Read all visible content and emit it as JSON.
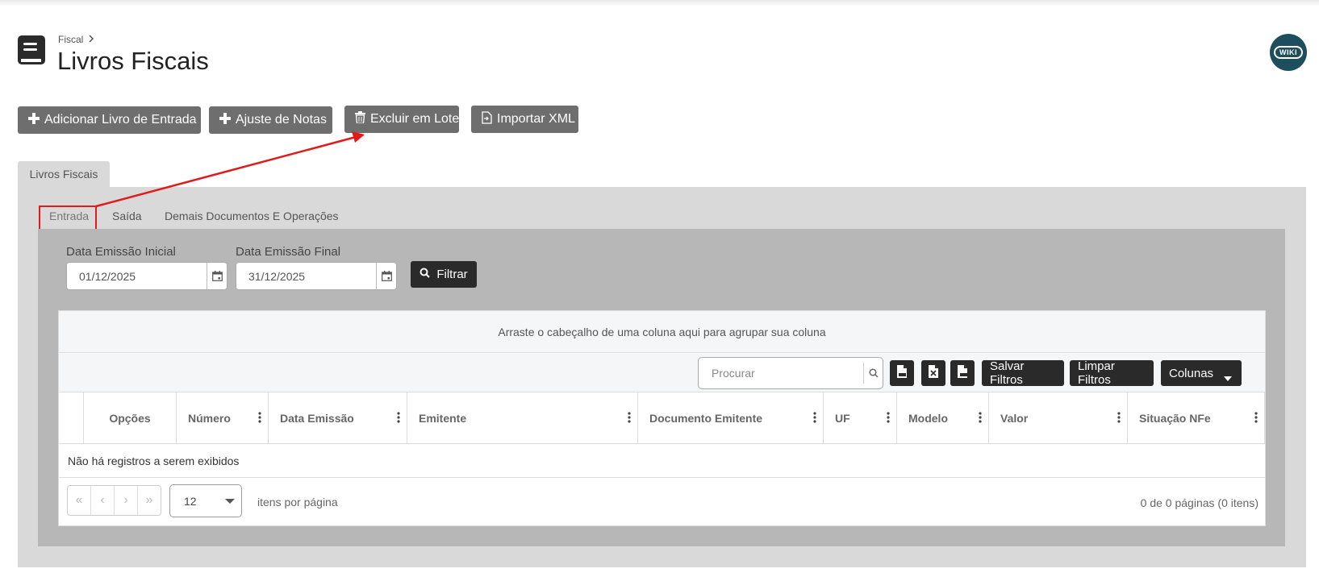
{
  "breadcrumb": {
    "parent": "Fiscal"
  },
  "page": {
    "title": "Livros Fiscais"
  },
  "wiki": {
    "label": "WIKI"
  },
  "actions": {
    "add_entry": "Adicionar Livro de Entrada",
    "adjust_notes": "Ajuste de Notas",
    "batch_delete": "Excluir em Lote",
    "import_xml": "Importar XML"
  },
  "main_tab": {
    "label": "Livros Fiscais"
  },
  "subtabs": [
    {
      "label": "Entrada",
      "active": true
    },
    {
      "label": "Saída",
      "active": false
    },
    {
      "label": "Demais Documentos E Operações",
      "active": false
    }
  ],
  "filters": {
    "start_label": "Data Emissão Inicial",
    "start_value": "01/12/2025",
    "end_label": "Data Emissão Final",
    "end_value": "31/12/2025",
    "filter_button": "Filtrar"
  },
  "grid": {
    "group_hint": "Arraste o cabeçalho de uma coluna aqui para agrupar sua coluna",
    "search_placeholder": "Procurar",
    "save_filters": "Salvar Filtros",
    "clear_filters": "Limpar Filtros",
    "columns_button": "Colunas",
    "columns": [
      "Opções",
      "Número",
      "Data Emissão",
      "Emitente",
      "Documento Emitente",
      "UF",
      "Modelo",
      "Valor",
      "Situação NFe"
    ],
    "empty_message": "Não há registros a serem exibidos",
    "page_size": "12",
    "per_page_label": "itens por página",
    "page_info": "0 de 0 páginas (0 itens)"
  },
  "colors": {
    "button_gray": "#6e6e6e",
    "button_dark": "#2a2a2a",
    "highlight_red": "#e01b1b",
    "wiki_bg": "#1d4e5e"
  }
}
